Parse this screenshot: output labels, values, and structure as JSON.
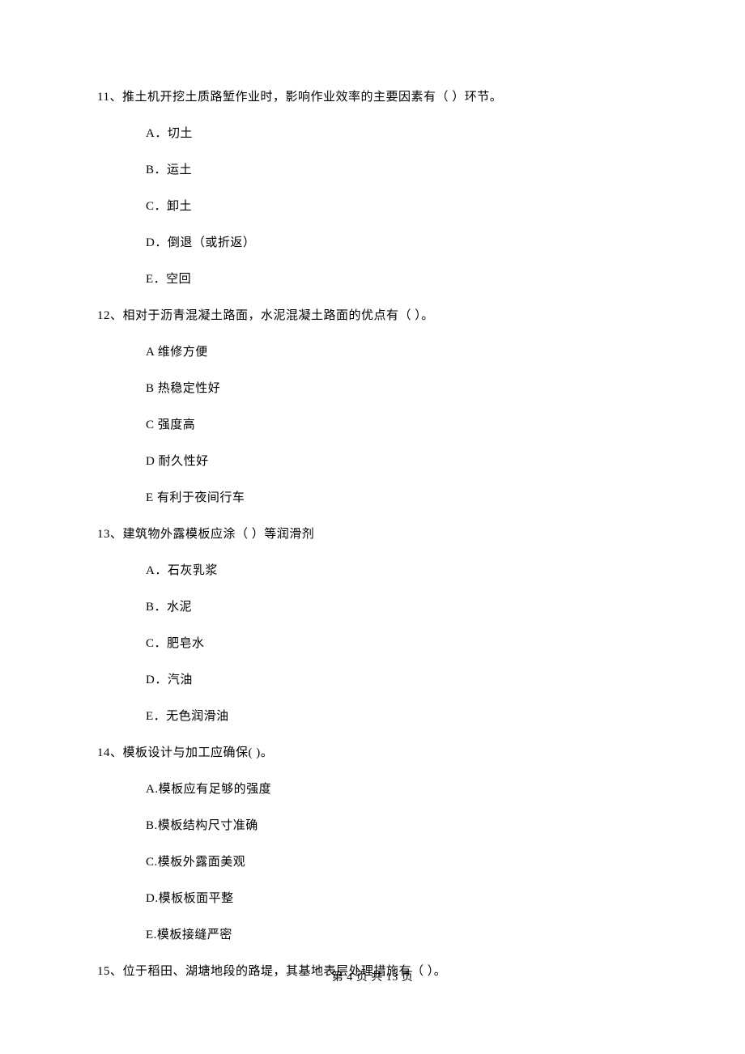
{
  "questions": [
    {
      "stem": "11、推土机开挖土质路堑作业时，影响作业效率的主要因素有（    ）环节。",
      "options": [
        "A．切土",
        "B．运土",
        "C．卸土",
        "D．倒退（或折返）",
        "E．空回"
      ]
    },
    {
      "stem": "12、相对于沥青混凝土路面，水泥混凝土路面的优点有（    ）。",
      "options": [
        "A 维修方便",
        "B 热稳定性好",
        "C 强度高",
        "D 耐久性好",
        "E 有利于夜间行车"
      ]
    },
    {
      "stem": "13、建筑物外露模板应涂（   ）等润滑剂",
      "options": [
        "A．石灰乳浆",
        "B．水泥",
        "C．肥皂水",
        "D．汽油",
        "E．无色润滑油"
      ]
    },
    {
      "stem": "14、模板设计与加工应确保(    )。",
      "options": [
        "A.模板应有足够的强度",
        "B.模板结构尺寸准确",
        "C.模板外露面美观",
        "D.模板板面平整",
        "E.模板接缝严密"
      ]
    },
    {
      "stem": "15、位于稻田、湖塘地段的路堤，其基地表层处理措施有（    ）。",
      "options": []
    }
  ],
  "footer": "第 4 页 共 13 页"
}
